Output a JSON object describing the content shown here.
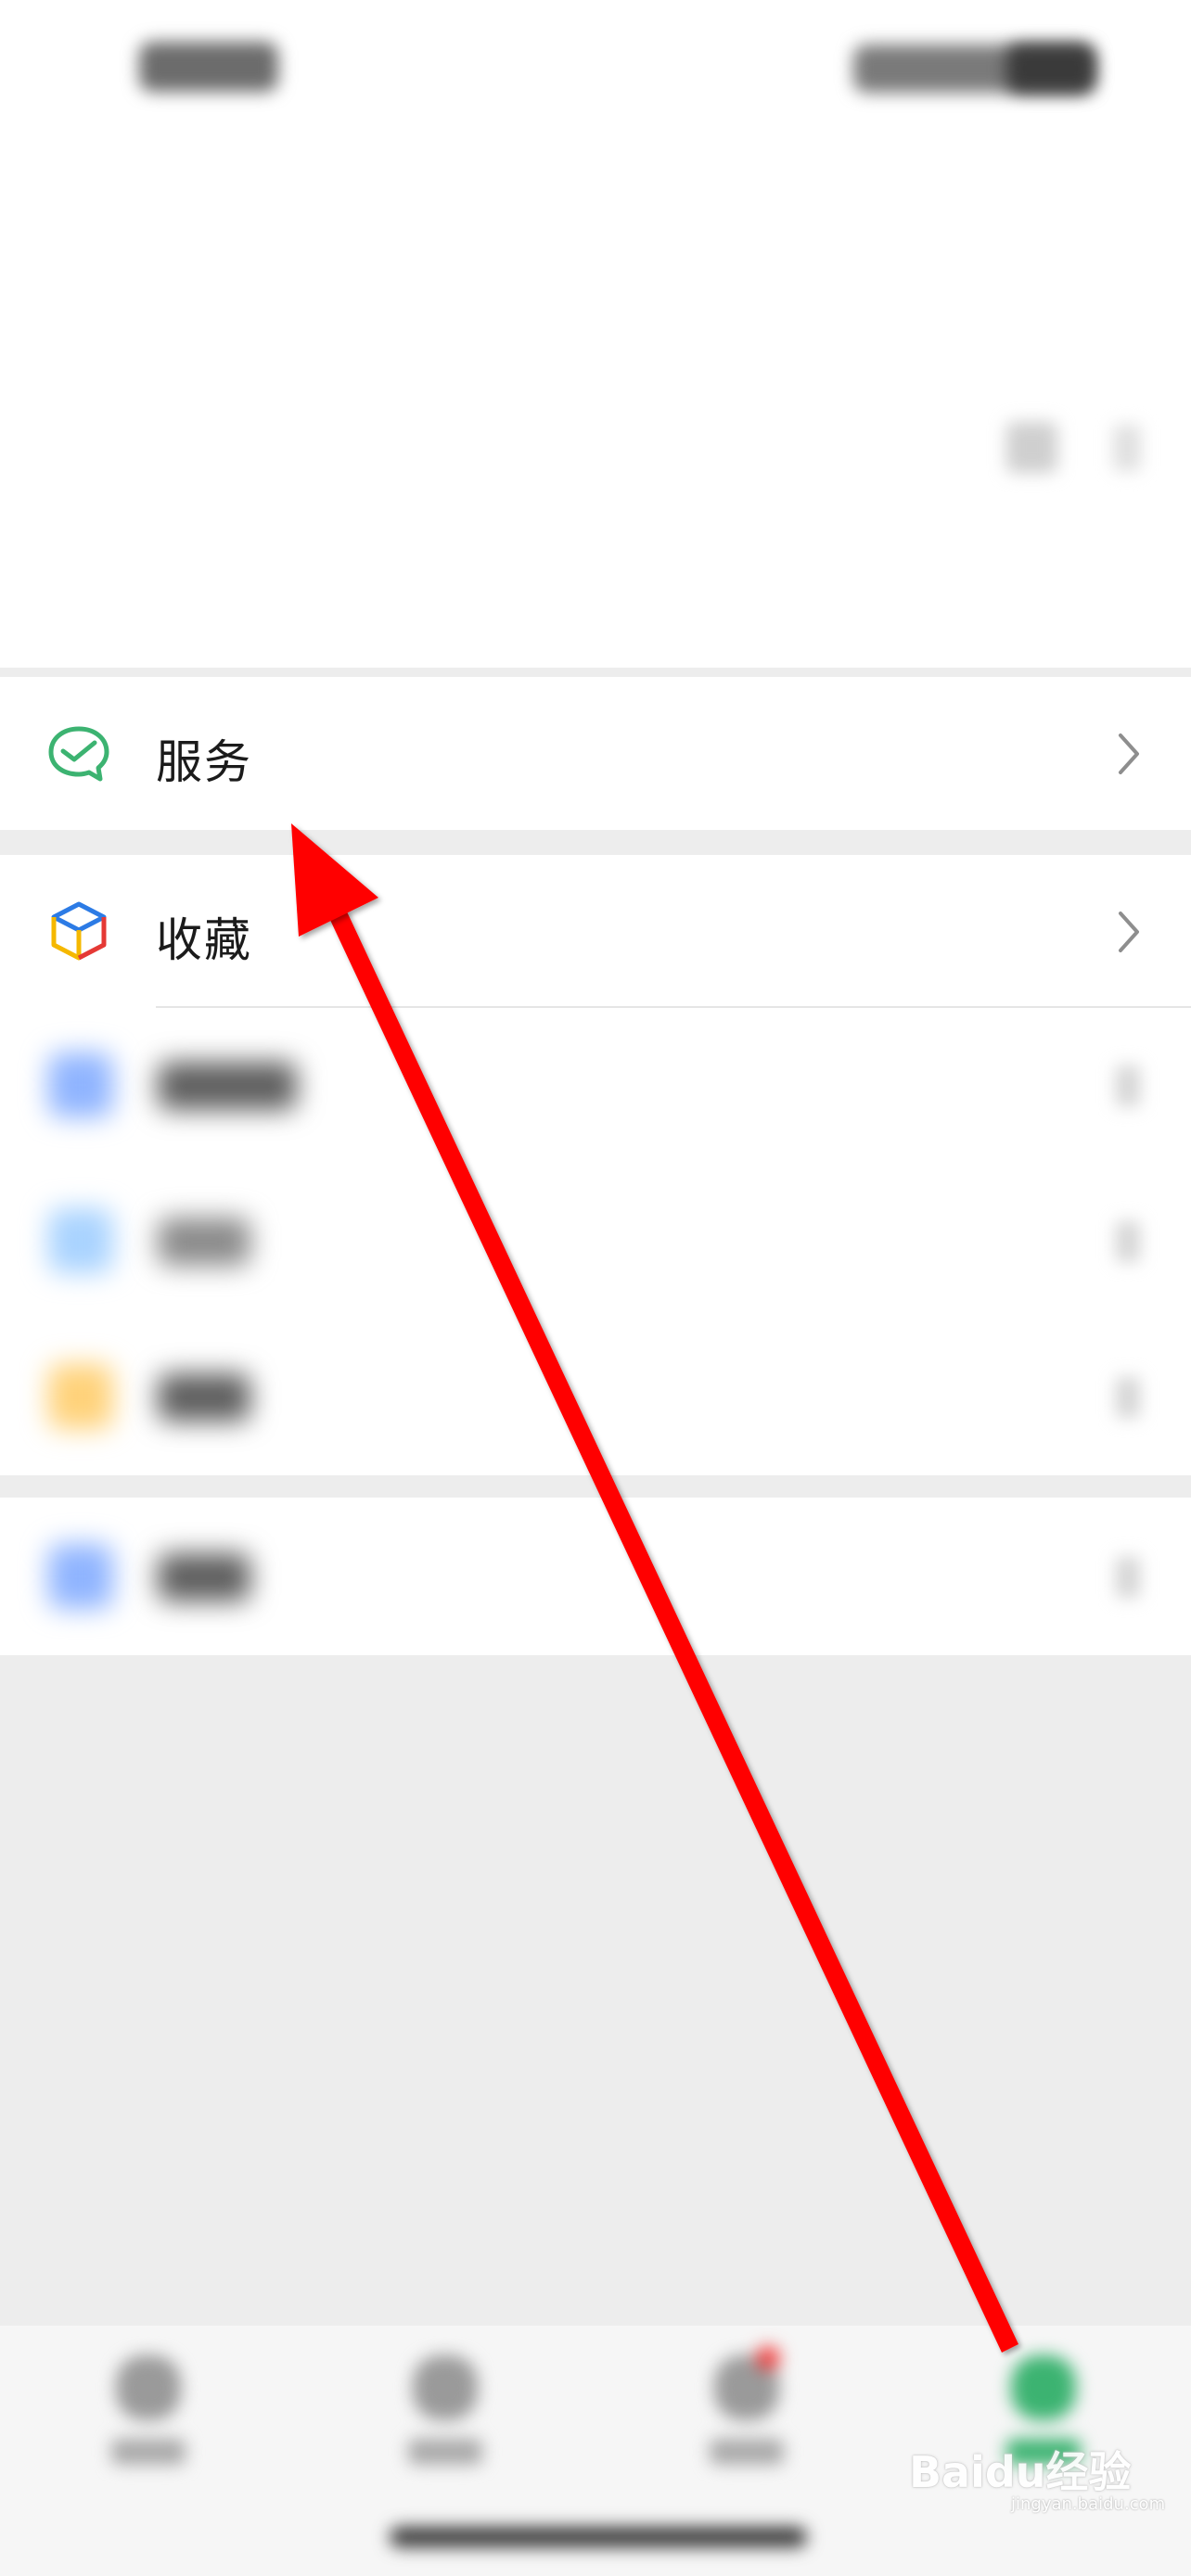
{
  "menu": {
    "services_label": "服务",
    "favorites_label": "收藏"
  },
  "watermark": {
    "text": "Baidu经验",
    "sub": "jingyan.baidu.com"
  },
  "colors": {
    "wechat_green": "#07c160",
    "annotation_red": "#ff0000",
    "background": "#ededed"
  },
  "icons": {
    "services": "wechat-pay-service-icon",
    "favorites": "favorites-cube-icon",
    "chevron": "chevron-right-icon"
  }
}
